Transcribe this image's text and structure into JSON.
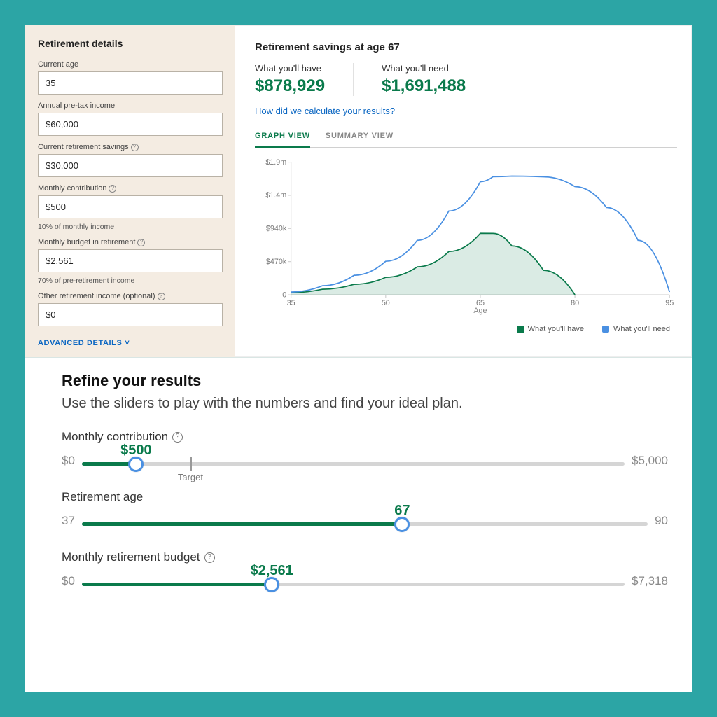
{
  "details": {
    "heading": "Retirement details",
    "fields": {
      "current_age": {
        "label": "Current age",
        "value": "35"
      },
      "income": {
        "label": "Annual pre-tax income",
        "value": "$60,000"
      },
      "savings": {
        "label": "Current retirement savings",
        "value": "$30,000",
        "help": true
      },
      "contribution": {
        "label": "Monthly contribution",
        "value": "$500",
        "help": true,
        "hint": "10% of monthly income"
      },
      "budget": {
        "label": "Monthly budget in retirement",
        "value": "$2,561",
        "help": true,
        "hint": "70% of pre-retirement income"
      },
      "other_income": {
        "label": "Other retirement income (optional)",
        "value": "$0",
        "help": true
      }
    },
    "advanced_label": "ADVANCED DETAILS"
  },
  "results": {
    "heading": "Retirement savings at age 67",
    "have": {
      "label": "What you'll have",
      "value": "$878,929"
    },
    "need": {
      "label": "What you'll need",
      "value": "$1,691,488"
    },
    "how_link": "How did we calculate your results?",
    "tabs": {
      "graph": "GRAPH VIEW",
      "summary": "SUMMARY VIEW"
    }
  },
  "chart_data": {
    "type": "area",
    "xlabel": "Age",
    "ylabel": "",
    "x_ticks": [
      35,
      50,
      65,
      80,
      95
    ],
    "y_ticks_labels": [
      "0",
      "$470k",
      "$940k",
      "$1.4m",
      "$1.9m"
    ],
    "ylim": [
      0,
      1900000
    ],
    "xlim": [
      35,
      95
    ],
    "legend": [
      "What you'll have",
      "What you'll need"
    ],
    "series": [
      {
        "name": "What you'll have",
        "color": "#0a7a4b",
        "fill": true,
        "points": [
          {
            "x": 35,
            "y": 30000
          },
          {
            "x": 40,
            "y": 80000
          },
          {
            "x": 45,
            "y": 150000
          },
          {
            "x": 50,
            "y": 250000
          },
          {
            "x": 55,
            "y": 400000
          },
          {
            "x": 60,
            "y": 620000
          },
          {
            "x": 65,
            "y": 880000
          },
          {
            "x": 67,
            "y": 878929
          },
          {
            "x": 70,
            "y": 700000
          },
          {
            "x": 75,
            "y": 350000
          },
          {
            "x": 80,
            "y": 0
          }
        ]
      },
      {
        "name": "What you'll need",
        "color": "#4a90e2",
        "fill": false,
        "points": [
          {
            "x": 35,
            "y": 40000
          },
          {
            "x": 40,
            "y": 130000
          },
          {
            "x": 45,
            "y": 280000
          },
          {
            "x": 50,
            "y": 480000
          },
          {
            "x": 55,
            "y": 780000
          },
          {
            "x": 60,
            "y": 1200000
          },
          {
            "x": 65,
            "y": 1620000
          },
          {
            "x": 67,
            "y": 1691488
          },
          {
            "x": 70,
            "y": 1700000
          },
          {
            "x": 75,
            "y": 1690000
          },
          {
            "x": 80,
            "y": 1550000
          },
          {
            "x": 85,
            "y": 1250000
          },
          {
            "x": 90,
            "y": 780000
          },
          {
            "x": 95,
            "y": 40000
          }
        ]
      }
    ]
  },
  "refine": {
    "heading": "Refine your results",
    "lead": "Use the sliders to play with the numbers and find your ideal plan.",
    "sliders": {
      "contribution": {
        "title": "Monthly contribution",
        "help": true,
        "min_label": "$0",
        "max_label": "$5,000",
        "min": 0,
        "max": 5000,
        "value": 500,
        "value_label": "$500",
        "target": 1000,
        "target_label": "Target"
      },
      "retire_age": {
        "title": "Retirement age",
        "help": false,
        "min_label": "37",
        "max_label": "90",
        "min": 37,
        "max": 90,
        "value": 67,
        "value_label": "67"
      },
      "budget": {
        "title": "Monthly retirement budget",
        "help": true,
        "min_label": "$0",
        "max_label": "$7,318",
        "min": 0,
        "max": 7318,
        "value": 2561,
        "value_label": "$2,561"
      }
    }
  }
}
